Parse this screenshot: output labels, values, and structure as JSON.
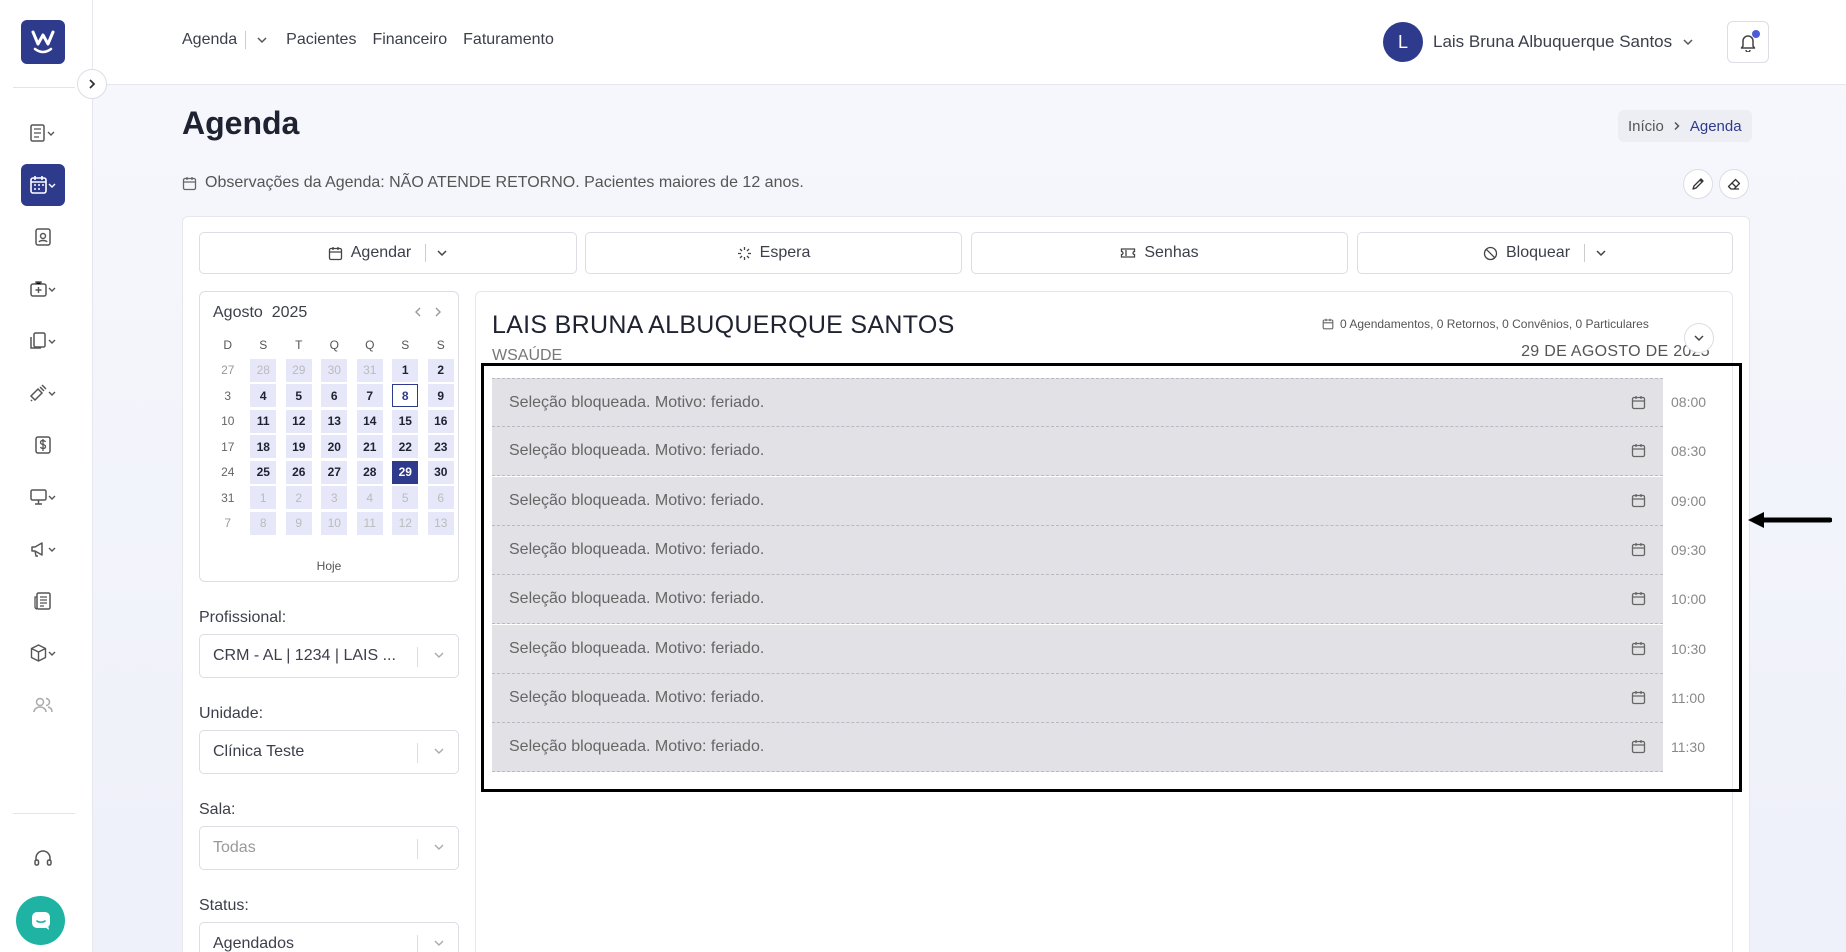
{
  "logo_text": "W",
  "nav": {
    "items": [
      "Agenda",
      "Pacientes",
      "Financeiro",
      "Faturamento"
    ]
  },
  "user": {
    "initial": "L",
    "name": "Lais Bruna Albuquerque Santos"
  },
  "page": {
    "title": "Agenda",
    "breadcrumb": [
      "Início",
      "Agenda"
    ],
    "observations": "Observações da Agenda: NÃO ATENDE RETORNO. Pacientes maiores de 12 anos."
  },
  "actions": {
    "agendar": "Agendar",
    "espera": "Espera",
    "senhas": "Senhas",
    "bloquear": "Bloquear"
  },
  "calendar": {
    "month": "Agosto",
    "year": "2025",
    "weekdays": [
      "D",
      "S",
      "T",
      "Q",
      "Q",
      "S",
      "S"
    ],
    "weeks": [
      [
        "27",
        "28",
        "29",
        "30",
        "31",
        "1",
        "2"
      ],
      [
        "3",
        "4",
        "5",
        "6",
        "7",
        "8",
        "9"
      ],
      [
        "10",
        "11",
        "12",
        "13",
        "14",
        "15",
        "16"
      ],
      [
        "17",
        "18",
        "19",
        "20",
        "21",
        "22",
        "23"
      ],
      [
        "24",
        "25",
        "26",
        "27",
        "28",
        "29",
        "30"
      ],
      [
        "31",
        "1",
        "2",
        "3",
        "4",
        "5",
        "6"
      ],
      [
        "7",
        "8",
        "9",
        "10",
        "11",
        "12",
        "13"
      ]
    ],
    "today_label": "Hoje",
    "today_day": "8",
    "selected_day": "29"
  },
  "filters": {
    "profissional_label": "Profissional:",
    "profissional_value": "CRM - AL | 1234 | LAIS ...",
    "unidade_label": "Unidade:",
    "unidade_value": "Clínica Teste",
    "sala_label": "Sala:",
    "sala_value": "Todas",
    "status_label": "Status:",
    "status_value": "Agendados"
  },
  "schedule": {
    "doctor": "LAIS BRUNA ALBUQUERQUE SANTOS",
    "org": "WSAÚDE",
    "stats": "0 Agendamentos, 0 Retornos, 0 Convênios, 0 Particulares",
    "date": "29 DE AGOSTO DE 2025",
    "slots": [
      {
        "text": "Seleção bloqueada. Motivo: feriado.",
        "time": "08:00"
      },
      {
        "text": "Seleção bloqueada. Motivo: feriado.",
        "time": "08:30"
      },
      {
        "text": "Seleção bloqueada. Motivo: feriado.",
        "time": "09:00"
      },
      {
        "text": "Seleção bloqueada. Motivo: feriado.",
        "time": "09:30"
      },
      {
        "text": "Seleção bloqueada. Motivo: feriado.",
        "time": "10:00"
      },
      {
        "text": "Seleção bloqueada. Motivo: feriado.",
        "time": "10:30"
      },
      {
        "text": "Seleção bloqueada. Motivo: feriado.",
        "time": "11:00"
      },
      {
        "text": "Seleção bloqueada. Motivo: feriado.",
        "time": "11:30"
      }
    ]
  },
  "colors": {
    "brand": "#2e3a8c",
    "chat": "#1eb3a2",
    "blocked_slot": "#e1e1e6"
  }
}
